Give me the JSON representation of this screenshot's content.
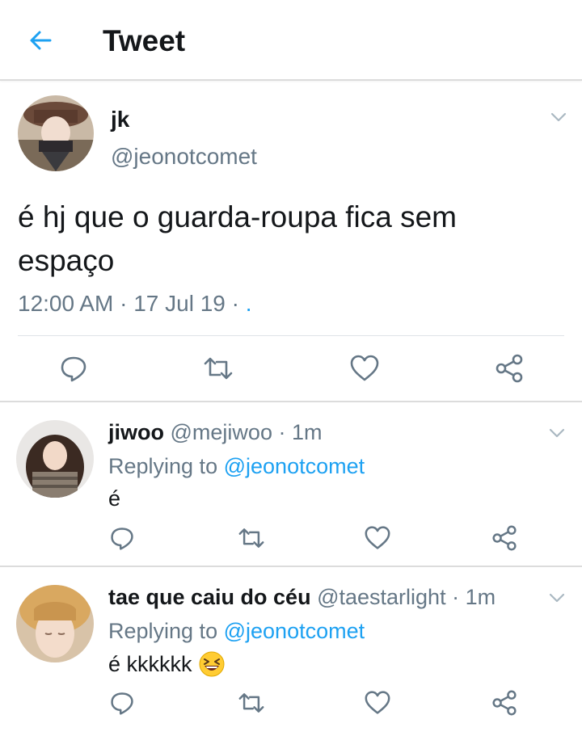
{
  "header": {
    "title": "Tweet",
    "back_icon": "arrow-left-icon",
    "accent": "#1da1f2"
  },
  "tweet": {
    "name": "jk",
    "handle": "@jeonotcomet",
    "text": "é hj que o guarda-roupa fica sem espaço",
    "time": "12:00 AM",
    "date": "17 Jul 19",
    "sep": "·",
    "dot_link": ".",
    "actions": [
      "reply-icon",
      "retweet-icon",
      "like-icon",
      "share-icon"
    ]
  },
  "replies": [
    {
      "name": "jiwoo",
      "handle": "@mejiwoo",
      "sep": "·",
      "time": "1m",
      "replying_label": "Replying to",
      "replying_to": "@jeonotcomet",
      "text": "é"
    },
    {
      "name": "tae que caiu do céu",
      "handle": "@taestarlight",
      "sep": "·",
      "time": "1m",
      "replying_label": "Replying to",
      "replying_to": "@jeonotcomet",
      "text": "é kkkkkk",
      "emoji": "laughing-squint-emoji"
    }
  ],
  "colors": {
    "text": "#14171a",
    "secondary": "#657786",
    "link": "#1da1f2",
    "border": "#dcdcdc"
  }
}
